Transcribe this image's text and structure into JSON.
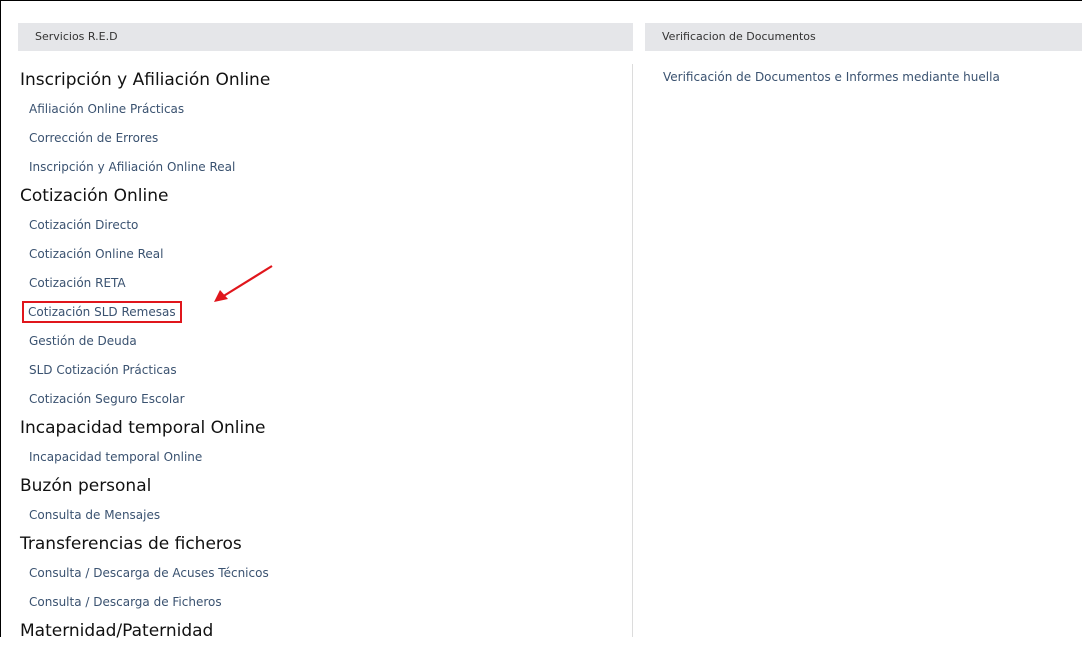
{
  "left_panel": {
    "title": "Servicios R.E.D",
    "sections": [
      {
        "category": "Inscripción y Afiliación Online",
        "items": [
          "Afiliación Online Prácticas",
          "Corrección de Errores",
          "Inscripción y Afiliación Online Real"
        ]
      },
      {
        "category": "Cotización Online",
        "items": [
          "Cotización Directo",
          "Cotización Online Real",
          "Cotización RETA",
          "Cotización SLD Remesas",
          "Gestión de Deuda",
          "SLD Cotización Prácticas",
          "Cotización Seguro Escolar"
        ]
      },
      {
        "category": "Incapacidad temporal Online",
        "items": [
          "Incapacidad temporal Online"
        ]
      },
      {
        "category": "Buzón personal",
        "items": [
          "Consulta de Mensajes"
        ]
      },
      {
        "category": "Transferencias de ficheros",
        "items": [
          "Consulta / Descarga de Acuses Técnicos",
          "Consulta / Descarga de Ficheros"
        ]
      },
      {
        "category": "Maternidad/Paternidad",
        "items": []
      }
    ],
    "highlighted_item": "Cotización SLD Remesas"
  },
  "right_panel": {
    "title": "Verificacion de Documentos",
    "link": "Verificación de Documentos e Informes mediante huella"
  },
  "colors": {
    "header_bg": "#e5e6e9",
    "link": "#3a5270",
    "highlight": "#e0161c"
  }
}
